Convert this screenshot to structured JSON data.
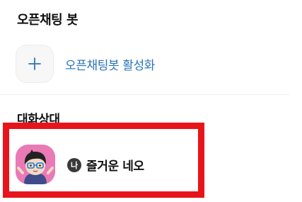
{
  "openchat_section": {
    "title": "오픈채팅 봇",
    "activate_label": "오픈채팅봇 활성화",
    "plus_icon": "plus-icon"
  },
  "conversation_section": {
    "title": "대화상대",
    "friends": [
      {
        "name": "즐거운 네오",
        "me_badge": "나",
        "avatar": "neo-character-avatar"
      }
    ]
  },
  "colors": {
    "link_blue": "#2a74b9",
    "highlight_red": "#e8141b",
    "avatar_pink": "#e97ab6"
  }
}
